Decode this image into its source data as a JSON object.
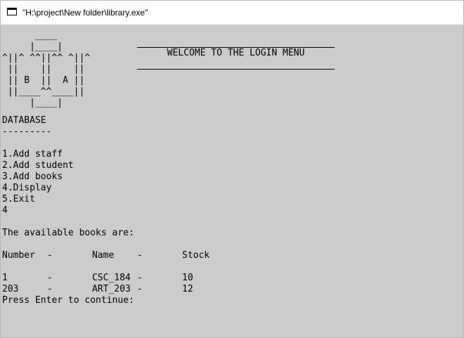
{
  "window": {
    "title": "\"H:\\project\\New folder\\library.exe\""
  },
  "console": {
    "logo_art": "      ____\n     |____|\n^||^ ^^||^^ ^||^\n ||    ||    ||\n || B  ||  A ||\n ||____^^____||\n     |____|",
    "banner": {
      "rule": "____________________________________",
      "title": "WELCOME TO THE LOGIN MENU"
    },
    "database_heading": "DATABASE",
    "database_underline": "---------",
    "menu": [
      "1.Add staff",
      "2.Add student",
      "3.Add books",
      "4.Display",
      "5.Exit"
    ],
    "user_input": "4",
    "books_heading": "The available books are:",
    "table": {
      "headers": [
        "Number",
        "-",
        "Name",
        "-",
        "Stock"
      ],
      "rows": [
        [
          "1",
          "-",
          "CSC_184",
          "-",
          "10"
        ],
        [
          "203",
          "-",
          "ART_203",
          "-",
          "12"
        ]
      ]
    },
    "prompt": "Press Enter to continue:"
  }
}
